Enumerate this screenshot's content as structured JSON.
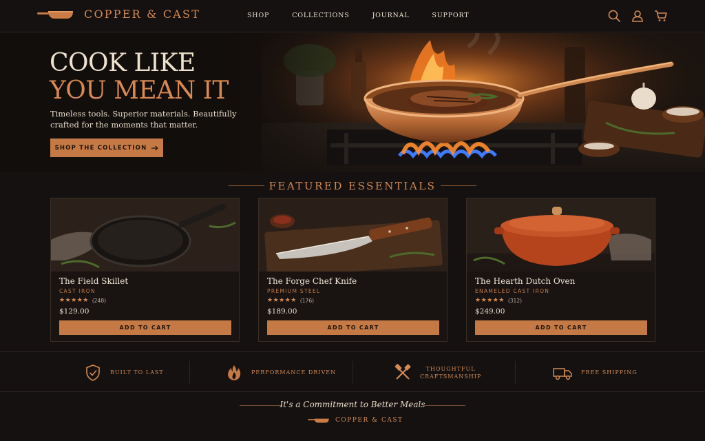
{
  "brand": {
    "name": "COPPER & CAST"
  },
  "nav": {
    "items": [
      "SHOP",
      "COLLECTIONS",
      "JOURNAL",
      "SUPPORT"
    ]
  },
  "header_icons": [
    "search-icon",
    "account-icon",
    "cart-icon"
  ],
  "hero": {
    "title_line1": "COOK LIKE",
    "title_line2": "YOU MEAN IT",
    "subtitle": "Timeless tools. Superior materials. Beautifully crafted for the moments that matter.",
    "cta_label": "SHOP THE COLLECTION",
    "cta_icon": "arrow-right-icon"
  },
  "featured": {
    "title": "FEATURED ESSENTIALS",
    "products": [
      {
        "name": "The Field Skillet",
        "material": "CAST IRON",
        "stars": "★★★★★",
        "reviews": "(248)",
        "rating": 5,
        "price": "$129.00",
        "button": "ADD TO CART"
      },
      {
        "name": "The Forge Chef Knife",
        "material": "PREMIUM STEEL",
        "stars": "★★★★★",
        "reviews": "(176)",
        "rating": 5,
        "price": "$189.00",
        "button": "ADD TO CART"
      },
      {
        "name": "The Hearth Dutch Oven",
        "material": "ENAMELED CAST IRON",
        "stars": "★★★★★",
        "reviews": "(312)",
        "rating": 5,
        "price": "$249.00",
        "button": "ADD TO CART"
      }
    ]
  },
  "features": [
    {
      "icon": "shield-check-icon",
      "label": "BUILT TO LAST"
    },
    {
      "icon": "flame-icon",
      "label": "PERFORMANCE DRIVEN"
    },
    {
      "icon": "crossed-tools-icon",
      "label_line1": "THOUGHTFUL",
      "label_line2": "CRAFTSMANSHIP"
    },
    {
      "icon": "truck-icon",
      "label": "FREE SHIPPING"
    }
  ],
  "footer": {
    "tagline": "It's a Commitment to Better Meals",
    "brand": "COPPER & CAST"
  },
  "colors": {
    "background": "#151110",
    "accent": "#d48a55",
    "button": "#c57a45",
    "text": "#efe2cf"
  }
}
